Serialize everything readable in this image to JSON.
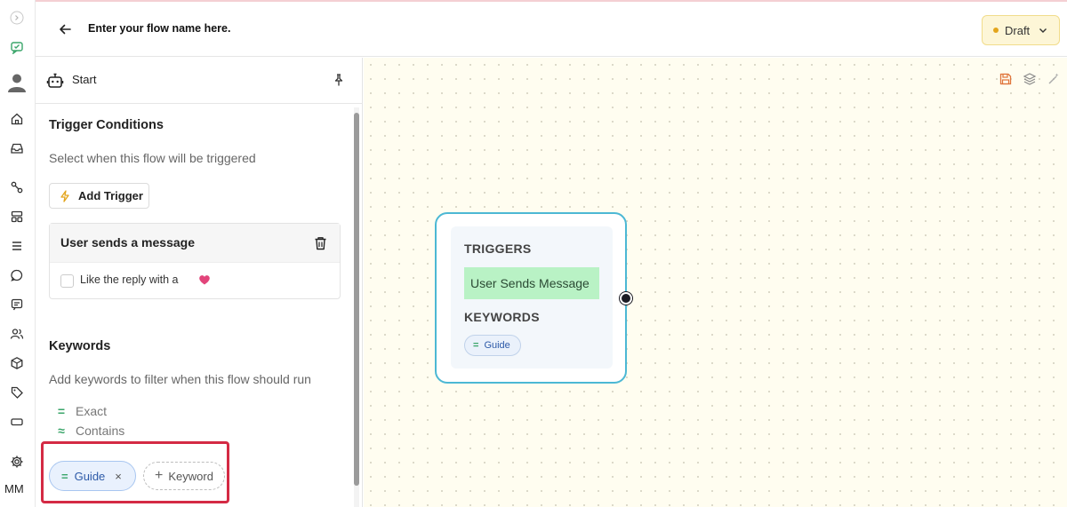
{
  "header": {
    "flow_name": "Enter your flow name here.",
    "status": "Draft"
  },
  "rail": {
    "user_initials": "MM"
  },
  "panel": {
    "title": "Start",
    "trigger_section": {
      "title": "Trigger Conditions",
      "subtitle": "Select when this flow will be triggered",
      "add_button": "Add Trigger",
      "card": {
        "title": "User sends a message",
        "option_label": "Like the reply with a"
      }
    },
    "keywords_section": {
      "title": "Keywords",
      "subtitle": "Add keywords to filter when this flow should run",
      "match_types": [
        {
          "symbol": "=",
          "label": "Exact"
        },
        {
          "symbol": "≈",
          "label": "Contains"
        }
      ],
      "keywords": [
        {
          "symbol": "=",
          "label": "Guide",
          "remove": "×"
        }
      ],
      "add_keyword": "Keyword",
      "add_symbol": "+"
    }
  },
  "node": {
    "triggers_label": "TRIGGERS",
    "trigger": "User Sends Message",
    "keywords_label": "KEYWORDS",
    "keyword": {
      "symbol": "=",
      "label": "Guide"
    }
  },
  "colors": {
    "accent_green": "#3aa56a",
    "highlight_red": "#d42a44",
    "node_border": "#4cb8d4",
    "draft_bg": "#fdf6d7",
    "canvas_bg": "#fffdf0"
  }
}
